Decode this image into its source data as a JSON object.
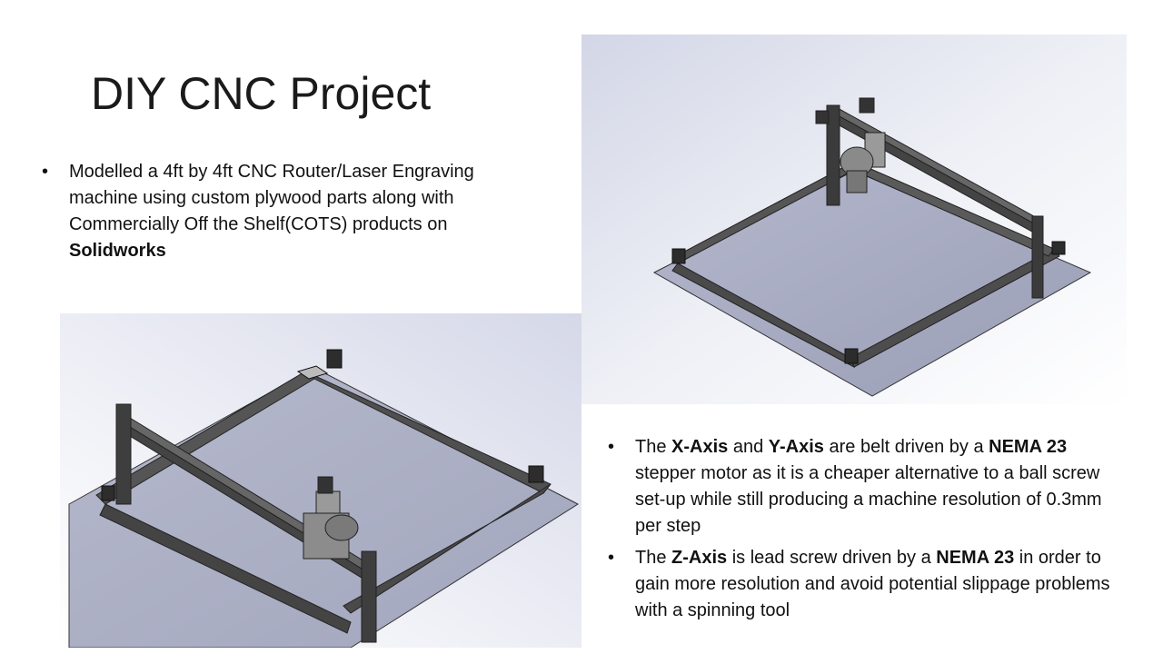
{
  "slide": {
    "title": "DIY CNC Project",
    "bullet1": {
      "text": "Modelled a 4ft by 4ft CNC Router/Laser Engraving machine using custom plywood parts along with Commercially Off the Shelf(COTS) products on ",
      "bold": "Solidworks"
    },
    "bullet2": {
      "t1": "The ",
      "b1": "X-Axis",
      "t2": " and ",
      "b2": "Y-Axis",
      "t3": " are belt driven by a ",
      "b3": "NEMA 23",
      "t4": " stepper motor as it is a cheaper alternative to a ball screw set-up while still producing a machine resolution of 0.3mm per step"
    },
    "bullet3": {
      "t1": "The ",
      "b1": "Z-Axis",
      "t2": " is lead screw driven by a ",
      "b2": "NEMA 23",
      "t3": " in order to gain more resolution and avoid potential slippage problems with a spinning tool"
    },
    "bullet_glyph": "•"
  }
}
